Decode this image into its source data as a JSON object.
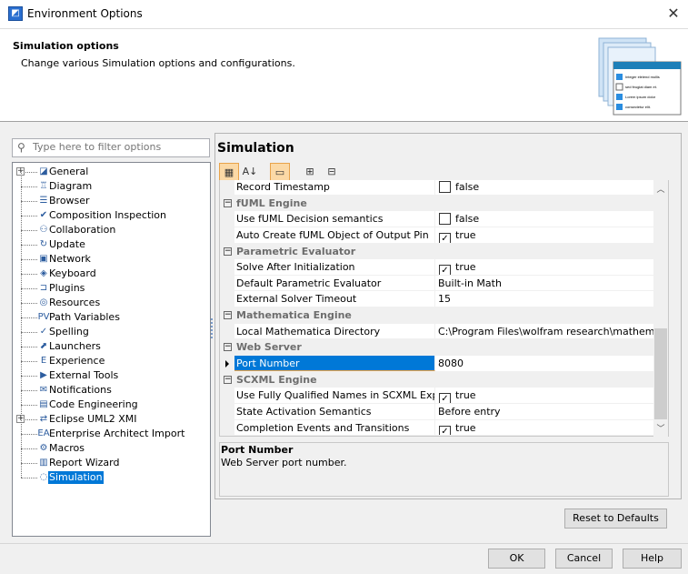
{
  "window": {
    "title": "Environment Options",
    "close": "✕"
  },
  "header": {
    "title": "Simulation options",
    "description": "Change various Simulation options and configurations.",
    "art_lines": [
      "Integer eleiend mollis",
      "sed feugiat diam et.",
      "Lorem ipsum dolor",
      "consectetur elit."
    ]
  },
  "filter": {
    "placeholder": "Type here to filter options",
    "value": ""
  },
  "tree": [
    {
      "label": "General",
      "icon": "general-icon",
      "expandable": true
    },
    {
      "label": "Diagram",
      "icon": "diagram-icon"
    },
    {
      "label": "Browser",
      "icon": "browser-icon"
    },
    {
      "label": "Composition Inspection",
      "icon": "composition-icon"
    },
    {
      "label": "Collaboration",
      "icon": "collaboration-icon"
    },
    {
      "label": "Update",
      "icon": "update-icon"
    },
    {
      "label": "Network",
      "icon": "network-icon"
    },
    {
      "label": "Keyboard",
      "icon": "keyboard-icon"
    },
    {
      "label": "Plugins",
      "icon": "plugin-icon"
    },
    {
      "label": "Resources",
      "icon": "resources-icon"
    },
    {
      "label": "Path Variables",
      "icon": "path-variables-icon"
    },
    {
      "label": "Spelling",
      "icon": "spelling-icon"
    },
    {
      "label": "Launchers",
      "icon": "launchers-icon"
    },
    {
      "label": "Experience",
      "icon": "experience-icon"
    },
    {
      "label": "External Tools",
      "icon": "external-tools-icon"
    },
    {
      "label": "Notifications",
      "icon": "notifications-icon"
    },
    {
      "label": "Code Engineering",
      "icon": "code-engineering-icon"
    },
    {
      "label": "Eclipse UML2 XMI",
      "icon": "eclipse-icon",
      "expandable": true
    },
    {
      "label": "Enterprise Architect Import",
      "icon": "ea-import-icon"
    },
    {
      "label": "Macros",
      "icon": "macros-icon"
    },
    {
      "label": "Report Wizard",
      "icon": "report-wizard-icon"
    },
    {
      "label": "Simulation",
      "icon": "simulation-icon",
      "selected": true
    }
  ],
  "panel": {
    "title": "Simulation"
  },
  "grid": [
    {
      "name": "Record Timestamp",
      "value": "false",
      "checkbox": false
    },
    {
      "group": "fUML Engine"
    },
    {
      "name": "Use fUML Decision semantics",
      "value": "false",
      "checkbox": false
    },
    {
      "name": "Auto Create fUML Object of Output Pin",
      "value": "true",
      "checkbox": true
    },
    {
      "group": "Parametric Evaluator"
    },
    {
      "name": "Solve After Initialization",
      "value": "true",
      "checkbox": true
    },
    {
      "name": "Default Parametric Evaluator",
      "value": "Built-in Math"
    },
    {
      "name": "External Solver Timeout",
      "value": "15"
    },
    {
      "group": "Mathematica Engine"
    },
    {
      "name": "Local Mathematica Directory",
      "value": "C:\\Program Files\\wolfram research\\mathematica\\"
    },
    {
      "group": "Web Server"
    },
    {
      "name": "Port Number",
      "value": "8080",
      "selected": true
    },
    {
      "group": "SCXML Engine"
    },
    {
      "name": "Use Fully Qualified Names in SCXML Export",
      "value": "true",
      "checkbox": true
    },
    {
      "name": "State Activation Semantics",
      "value": "Before entry"
    },
    {
      "name": "Completion Events and Transitions",
      "value": "true",
      "checkbox": true
    }
  ],
  "description": {
    "title": "Port Number",
    "text": "Web Server port number."
  },
  "buttons": {
    "reset": "Reset to Defaults",
    "ok": "OK",
    "cancel": "Cancel",
    "help": "Help"
  }
}
